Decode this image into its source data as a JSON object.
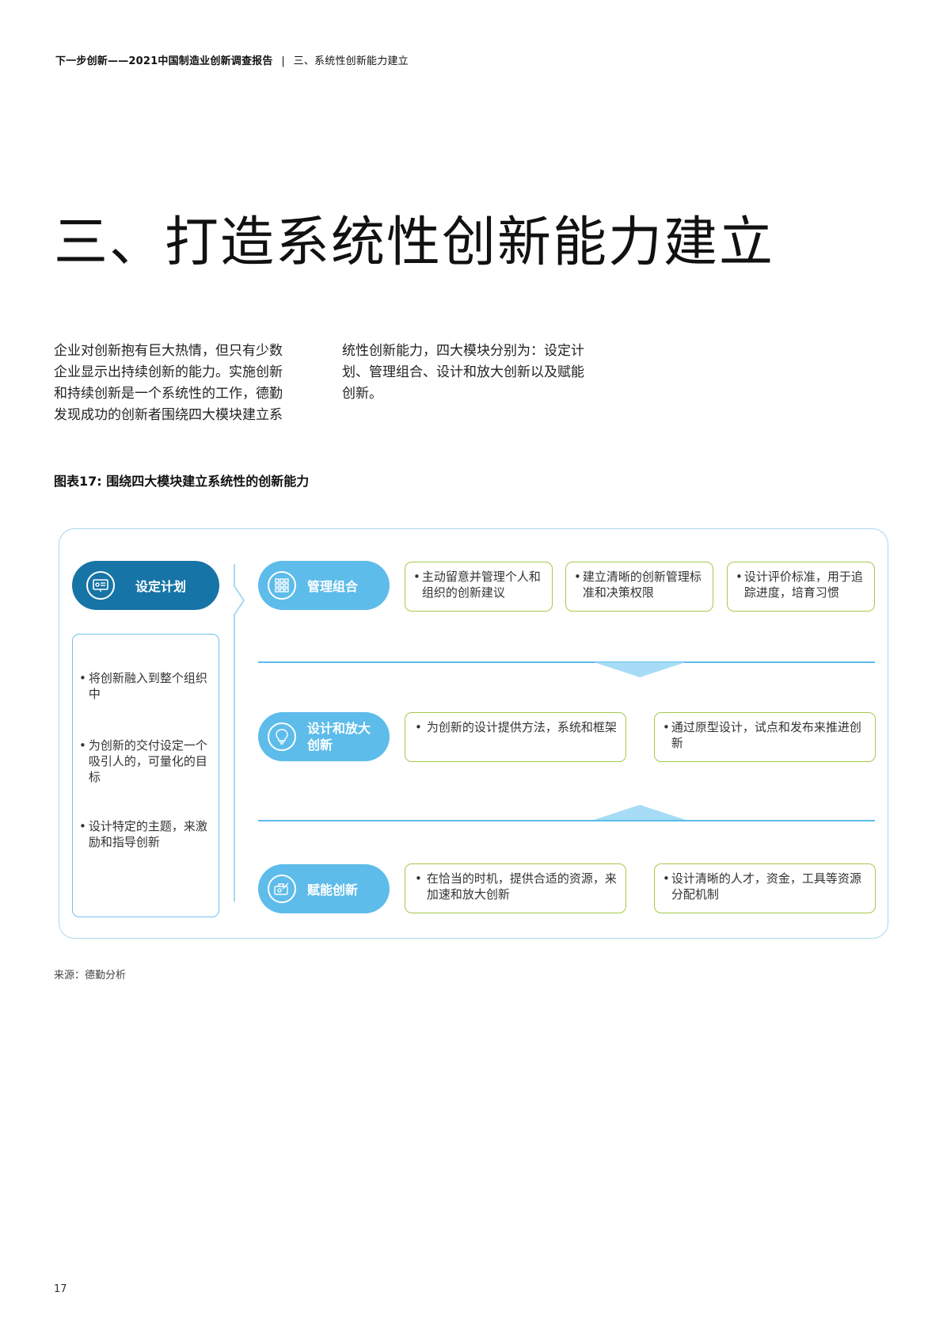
{
  "header": {
    "report": "下一步创新——2021中国制造业创新调查报告",
    "separator": "|",
    "section": "三、系统性创新能力建立"
  },
  "title": "三、打造系统性创新能力建立",
  "intro": {
    "left_lines": [
      "企业对创新抱有巨大热情，但只有少数",
      "企业显示出持续创新的能力。实施创新",
      "和持续创新是一个系统性的工作，德勤",
      "发现成功的创新者围绕四大模块建立系"
    ],
    "right_lines": [
      "统性创新能力，四大模块分别为：设定计",
      "划、管理组合、设计和放大创新以及赋能",
      "创新。"
    ]
  },
  "figure": {
    "title": "图表17: 围绕四大模块建立系统性的创新能力",
    "plan": {
      "label": "设定计划",
      "icon": "presentation-icon",
      "bullets": [
        "将创新融入到整个组织中",
        "为创新的交付设定一个吸引人的，可量化的目标",
        "设计特定的主题，来激励和指导创新"
      ]
    },
    "modules": [
      {
        "label": "管理组合",
        "icon": "grid-icon",
        "items": [
          "主动留意并管理个人和组织的创新建议",
          "建立清晰的创新管理标准和决策权限",
          "设计评价标准，用于追踪进度，培育习惯"
        ]
      },
      {
        "label": "设计和放大创新",
        "icon": "lightbulb-icon",
        "items": [
          "为创新的设计提供方法，系统和框架",
          "通过原型设计，试点和发布来推进创新"
        ]
      },
      {
        "label": "赋能创新",
        "icon": "toolbox-icon",
        "items": [
          "在恰当的时机，提供合适的资源，来加速和放大创新",
          "设计清晰的人才，资金，工具等资源分配机制"
        ]
      }
    ],
    "colors": {
      "dark_blue": "#1774a6",
      "light_blue": "#5dbcea",
      "green_border": "#a6c94c",
      "frame_border": "#a9d7f1"
    }
  },
  "source": "来源：德勤分析",
  "page_number": "17"
}
